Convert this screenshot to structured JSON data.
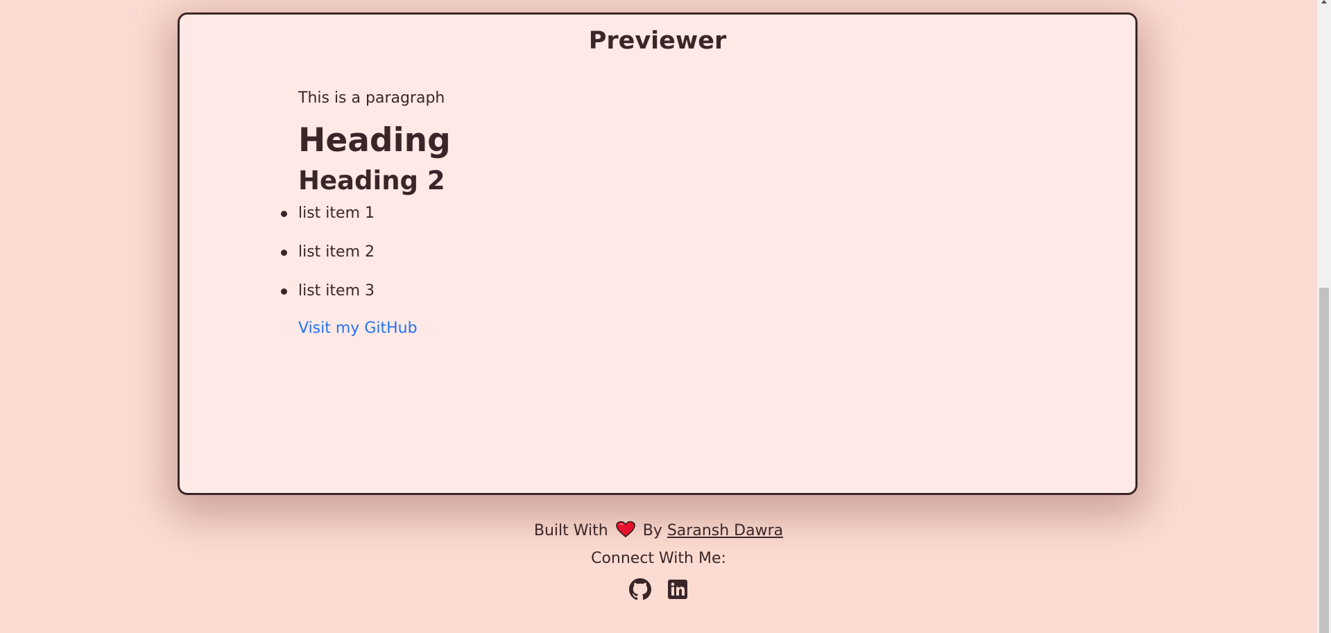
{
  "previewer": {
    "title": "Previewer",
    "paragraph": "This is a paragraph",
    "heading1": "Heading",
    "heading2": "Heading 2",
    "list_items": [
      "list item 1",
      "list item 2",
      "list item 3"
    ],
    "link_text": "Visit my GitHub"
  },
  "footer": {
    "built_with": "Built With",
    "by": "By",
    "author": "Saransh Dawra",
    "connect": "Connect With Me:",
    "icons": [
      "heart-icon",
      "github-icon",
      "linkedin-icon"
    ]
  },
  "colors": {
    "page_background": "#fcdcd2",
    "panel_background": "#fee9e6",
    "text": "#3a2628",
    "link": "#2473f0",
    "heart": "#e8112d"
  }
}
